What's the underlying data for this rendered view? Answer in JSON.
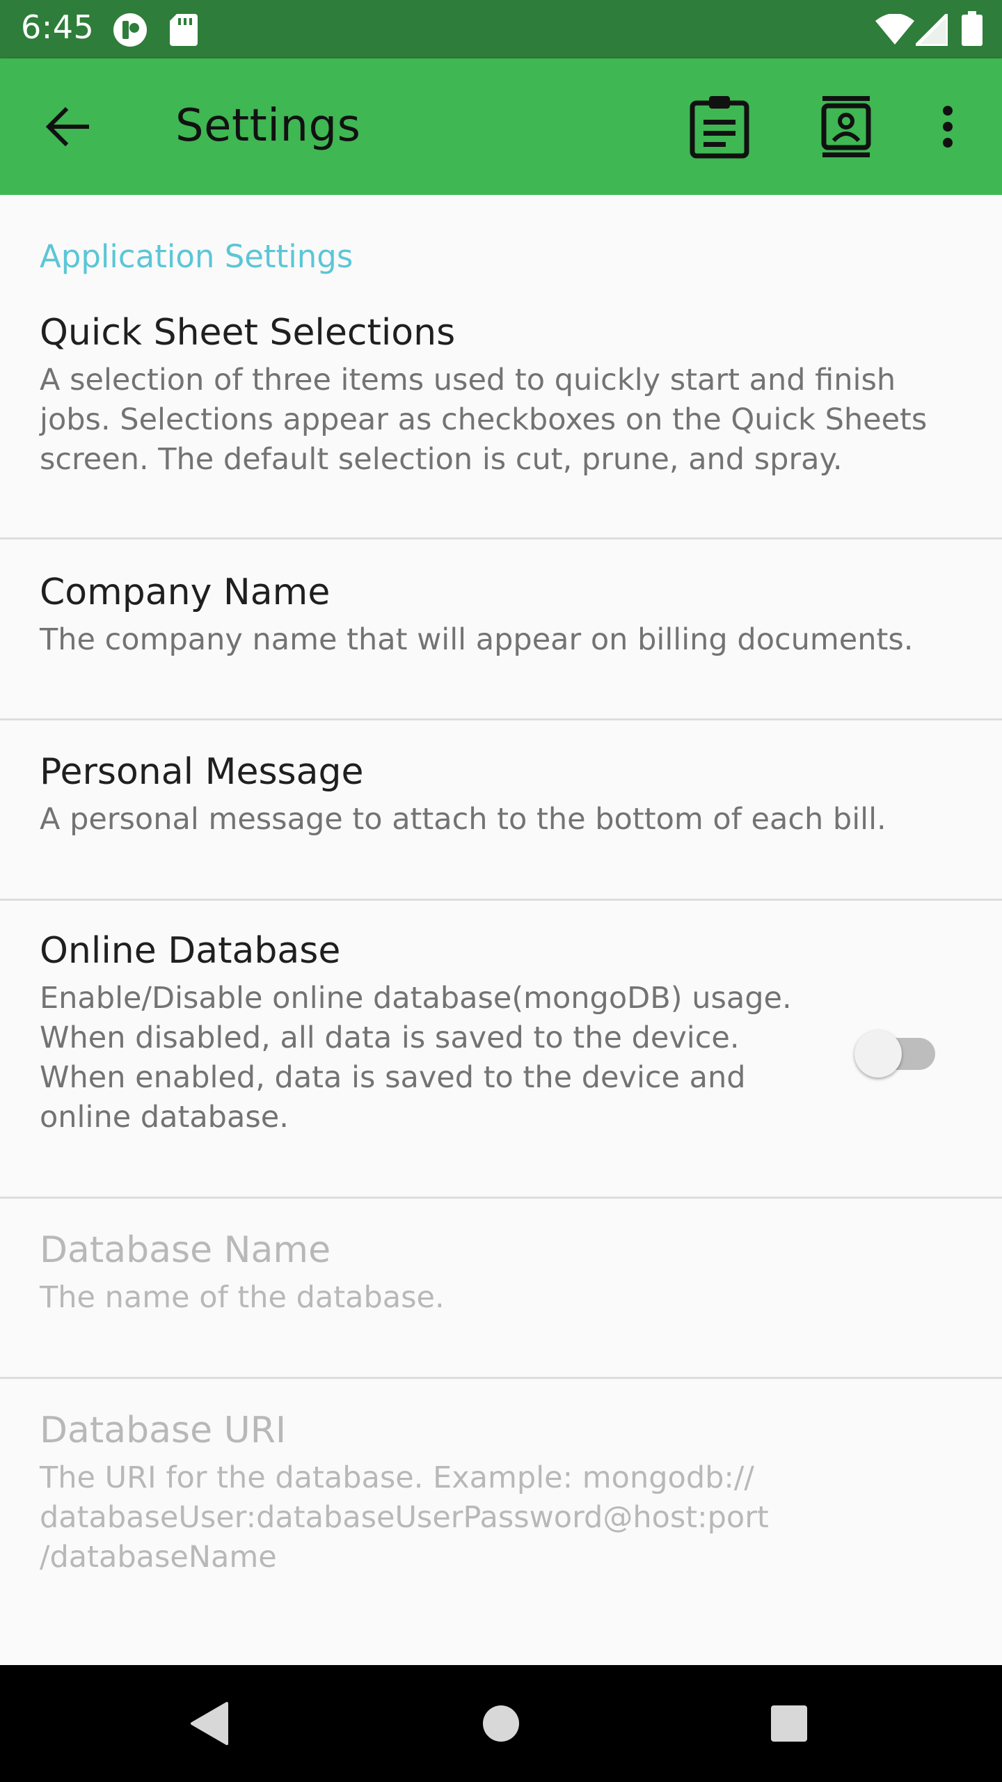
{
  "status_bar": {
    "time": "6:45",
    "left_icons": [
      "sync-status-icon",
      "sd-card-icon"
    ],
    "right_icons": [
      "wifi-icon",
      "cell-signal-icon",
      "battery-icon"
    ]
  },
  "app_bar": {
    "title": "Settings",
    "back_icon": "arrow-back-icon",
    "actions": [
      "clipboard-icon",
      "contact-book-icon",
      "more-vert-icon"
    ],
    "color": "#3fb753"
  },
  "category": {
    "label": "Application Settings",
    "color": "#5bc6d6"
  },
  "preferences": [
    {
      "title": "Quick Sheet Selections",
      "summary": "A selection of three items used to quickly start and finish jobs. Selections appear as checkboxes on the Quick Sheets screen. The default selection is cut, prune, and spray.",
      "enabled": true
    },
    {
      "title": "Company Name",
      "summary": "The company name that will appear on billing documents.",
      "enabled": true
    },
    {
      "title": "Personal Message",
      "summary": "A personal message to attach to the bottom of each bill.",
      "enabled": true
    },
    {
      "title": "Online Database",
      "summary": "Enable/Disable online database(mongoDB) usage. When disabled, all data is saved to the device. When enabled, data is saved to the device and online database.",
      "enabled": true,
      "switch_on": false
    },
    {
      "title": "Database Name",
      "summary": "The name of the database.",
      "enabled": false
    },
    {
      "title": "Database URI",
      "summary": "The URI for the database. Example: mongodb://\ndatabaseUser:databaseUserPassword@host:port\n/databaseName",
      "enabled": false
    }
  ],
  "nav_bar": {
    "buttons": [
      "back-triangle-icon",
      "home-circle-icon",
      "recents-square-icon"
    ]
  }
}
